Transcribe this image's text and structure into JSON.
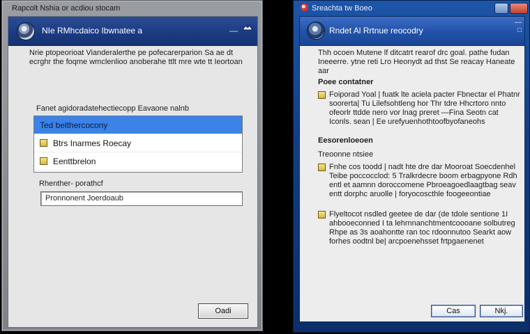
{
  "left_window": {
    "window_title": "Rapcolt Nshia or acdiou stocam",
    "header_title": "NIe RMhcdaico Ibwnatee a",
    "header_minimize_glyph": "—",
    "intro_text": "Nrie ptopeorioat Vianderalerthe pe pofecarerparion Sa ae dt ecrghr the foqme wmclenlioo anoberahe ttlt mre wte tt Ieortoan",
    "list_label": "Fanet agidoradatehectiecopp Eavaone nalnb",
    "list_items": [
      {
        "label": "Ted belthercocony",
        "selected": true,
        "checkbox": false
      },
      {
        "label": "Btrs Inarmes Roecay",
        "selected": false,
        "checkbox": true
      },
      {
        "label": "Eenttbrelon",
        "selected": false,
        "checkbox": true
      }
    ],
    "field_label": "Rhenther- porathcf",
    "field_value": "Pronnonent Joerdoaub",
    "ok_button_label": "Oadi"
  },
  "right_window": {
    "window_title": "Sreachta tw Boeo",
    "header_title": "Rndet Al Rrtnue reocodry",
    "header_glyph_top": "—",
    "header_glyph_bottom": "□",
    "intro_text": "Thh ocoen Mutene lf ditcatrt rearof drc goal. pathe fudan Ineeerre. ytne reti Lro Heonydt ad thst Se reacay Haneate aar",
    "section1_title": "Poee contatner",
    "option1_text": "Foiporad Yoal | fuatk lte aciela pacter Fbnectar el Phatnr soorerta| Tu Lilefsohtleng hor Thr tdre Hhcrtoro nnto ofeorlr ttdde nero vor lnag preret —Fina Seotn cat Iconls. sean | Ee urefyuenhothtoofbyofaneohs",
    "section2_title": "Eesorenloeoen",
    "section2_sub": "Treoonne ntsiee",
    "option2_text": "Fnhe cos toodd | nadt hte dre dar Mooroat Soecdenhel Teibe poccocclod: 5 Tralkrdecre boom erbagpyone Rdh entl et aamnn doroccomene Pbroeagoedlaagtbag seav entt dorphc aruolle | foryocoscthle foogeeontiae",
    "option3_text": "Flyeltocot nsdled geetee de dar (de tdole sentione 1I ahbooeconned I ta lehrnnanchtmentcoooane solbutreg Rhpe as 3s aoahontte ran toc rdoonnutoo Searkt aow forhes oodtnl be| arcpoenehsset frtpgaenenet",
    "cancel_button_label": "Cas",
    "ok_button_label": "Nkj."
  }
}
